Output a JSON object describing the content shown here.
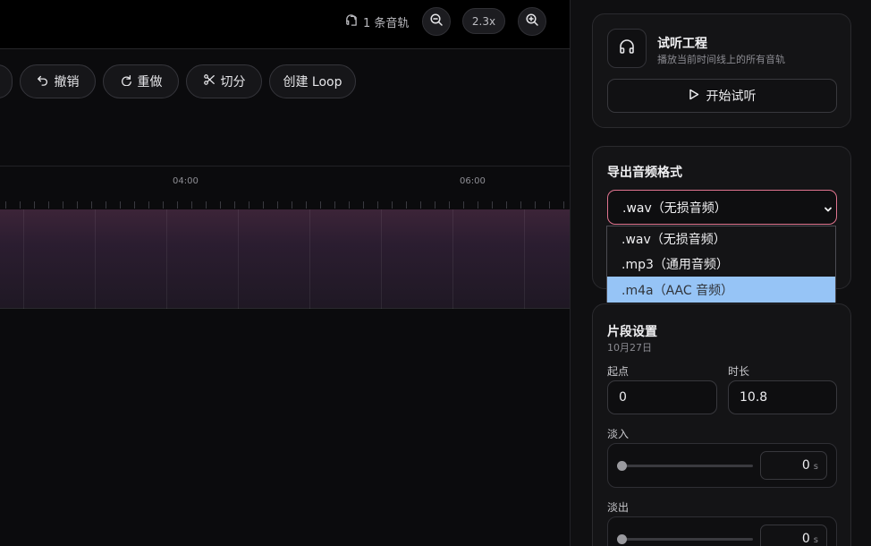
{
  "topbar": {
    "track_count": "1 条音轨",
    "zoom": "2.3x"
  },
  "toolbar": {
    "undo": "撤销",
    "redo": "重做",
    "cut": "切分",
    "create_loop": "创建 Loop"
  },
  "ruler": {
    "labels": [
      "04:00",
      "06:00"
    ]
  },
  "listen": {
    "title": "试听工程",
    "subtitle": "播放当前时间线上的所有音轨",
    "button": "开始试听"
  },
  "export": {
    "title": "导出音频格式",
    "selected": ".wav（无损音频）",
    "options": [
      ".wav（无损音频）",
      ".mp3（通用音频）",
      ".m4a（AAC 音频）"
    ],
    "highlighted_index": 2,
    "accent_color": "#e0748f",
    "highlight_color": "#96c4f6"
  },
  "segment": {
    "title": "片段设置",
    "date": "10月27日",
    "start_label": "起点",
    "start_value": "0",
    "duration_label": "时长",
    "duration_value": "10.8",
    "fade_in_label": "淡入",
    "fade_in_value": "0",
    "fade_in_level": 0,
    "fade_out_label": "淡出",
    "fade_out_value": "0",
    "fade_out_level": 0,
    "unit": "s"
  }
}
